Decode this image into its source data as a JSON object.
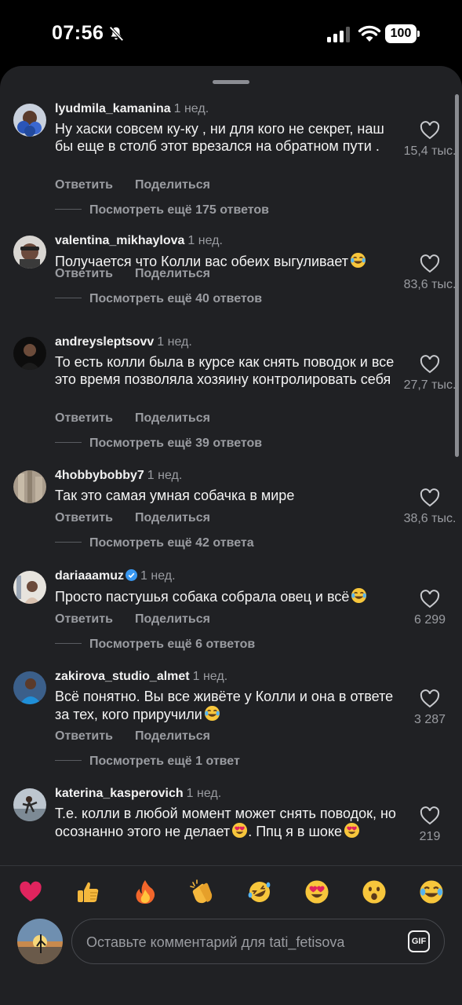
{
  "status_bar": {
    "time": "07:56",
    "battery": "100"
  },
  "comments": [
    {
      "username": "lyudmila_kamanina",
      "time": "1 нед.",
      "text": "Ну хаски совсем ку-ку , ни для кого не секрет, наш бы еще в столб этот врезался на обратном пути .",
      "reply": "Ответить",
      "share": "Поделиться",
      "more": "Посмотреть ещё 175 ответов",
      "likes": "15,4 тыс."
    },
    {
      "username": "valentina_mikhaylova",
      "time": "1 нед.",
      "text": "Получается что Колли вас обеих выгуливает",
      "emoji": "laugh",
      "reply": "Ответить",
      "share": "Поделиться",
      "more": "Посмотреть ещё 40 ответов",
      "likes": "83,6 тыс."
    },
    {
      "username": "andreysleptsovv",
      "time": "1 нед.",
      "text": "То есть колли была в курсе как снять поводок и все это время позволяла хозяину контролировать себя",
      "reply": "Ответить",
      "share": "Поделиться",
      "more": "Посмотреть ещё 39 ответов",
      "likes": "27,7 тыс."
    },
    {
      "username": "4hobbybobby7",
      "time": "1 нед.",
      "text": "Так это самая умная собачка в мире",
      "reply": "Ответить",
      "share": "Поделиться",
      "more": "Посмотреть ещё 42 ответа",
      "likes": "38,6 тыс."
    },
    {
      "username": "dariaaamuz",
      "verified": true,
      "time": "1 нед.",
      "text": "Просто пастушья собака собрала овец и всё",
      "emoji": "laugh",
      "reply": "Ответить",
      "share": "Поделиться",
      "more": "Посмотреть ещё 6 ответов",
      "likes": "6 299"
    },
    {
      "username": "zakirova_studio_almet",
      "time": "1 нед.",
      "text": "Всё понятно. Вы все живёте у Колли и она в ответе за тех, кого приручили",
      "emoji": "laugh",
      "reply": "Ответить",
      "share": "Поделиться",
      "more": "Посмотреть ещё 1 ответ",
      "likes": "3 287"
    },
    {
      "username": "katerina_kasperovich",
      "time": "1 нед.",
      "text_part1": "Т.е. колли в любой момент может снять поводок, но осознанно этого не делает",
      "text_part2": ". Ппц я в шоке",
      "likes": "219"
    }
  ],
  "reactions": [
    {
      "name": "heart",
      "char": "❤️",
      "color": "#e0245e"
    },
    {
      "name": "thumbs-up",
      "char": "👍",
      "color": "#f5b83d"
    },
    {
      "name": "fire",
      "char": "🔥",
      "color": "#f2662b"
    },
    {
      "name": "clapping-hands",
      "char": "👏",
      "color": "#f5b83d"
    },
    {
      "name": "rofl",
      "char": "🤣",
      "color": "#f7c63c"
    },
    {
      "name": "heart-eyes",
      "char": "😍",
      "color": "#f7c63c"
    },
    {
      "name": "surprised",
      "char": "😮",
      "color": "#f7c63c"
    },
    {
      "name": "tears-of-joy",
      "char": "😂",
      "color": "#f7c63c"
    }
  ],
  "composer": {
    "placeholder": "Оставьте комментарий для tati_fetisova",
    "gif_label": "GIF"
  }
}
